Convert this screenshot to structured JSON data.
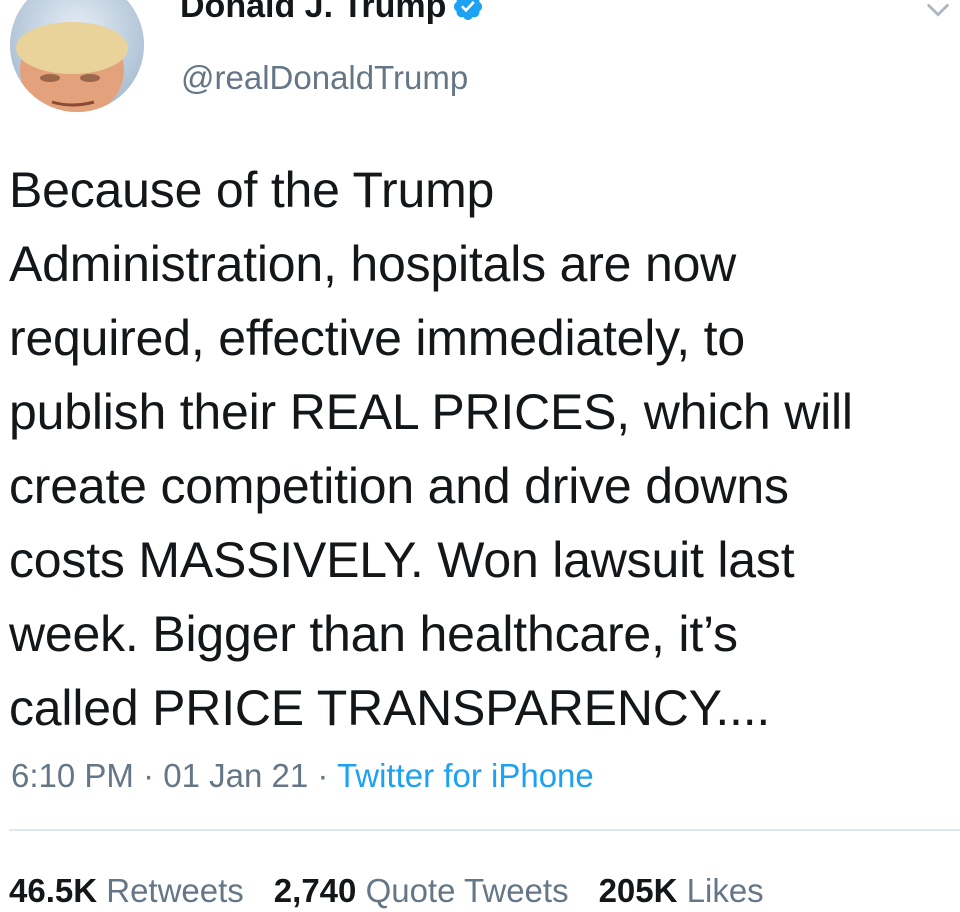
{
  "author": {
    "display_name": "Donald J. Trump",
    "handle": "@realDonaldTrump",
    "verified": true,
    "verified_color": "#1da1f2",
    "avatar_icon": "profile-photo"
  },
  "tweet": {
    "text": "Because of the Trump\nAdministration, hospitals are now\nrequired, effective immediately, to\npublish their REAL PRICES, which will\ncreate competition and drive downs\ncosts MASSIVELY. Won lawsuit last\nweek. Bigger than healthcare, it’s\ncalled PRICE TRANSPARENCY....",
    "time": "6:10 PM",
    "separator": "·",
    "date": "01 Jan 21",
    "source": "Twitter for iPhone"
  },
  "stats": {
    "retweets_count": "46.5K",
    "retweets_label": "Retweets",
    "quotes_count": "2,740",
    "quotes_label": "Quote Tweets",
    "likes_count": "205K",
    "likes_label": "Likes"
  },
  "colors": {
    "text": "#14171a",
    "secondary": "#657786",
    "link": "#1da1f2",
    "divider": "#e1e8ed"
  }
}
